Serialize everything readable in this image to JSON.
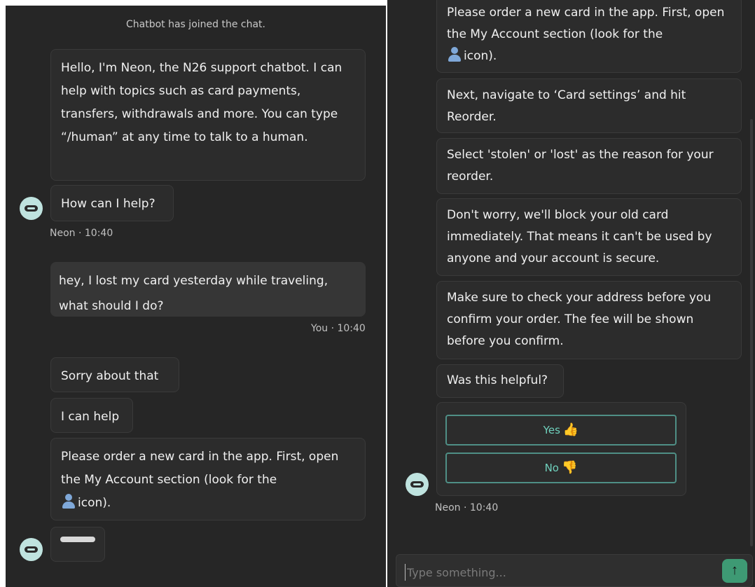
{
  "left": {
    "system_note": "Chatbot has joined the chat.",
    "greeting_text": "Hello, I'm Neon, the N26 support chatbot. I can help with topics such as card payments, transfers, withdrawals and more. You can type “/human” at any time to talk to a human.",
    "how_help": "How can I help?",
    "bot_meta": "Neon · 10:40",
    "user_text": "hey, I lost my card yesterday while traveling, what should I do?",
    "user_meta": "You · 10:40",
    "sorry": "Sorry about that",
    "can_help": "I can help",
    "order_text_a": "Please order a new card in the app. First, open the My Account section (look for the",
    "order_text_b": "icon)."
  },
  "right": {
    "order_text_a": "Please order a new card in the app. First, open the My Account section (look for the",
    "order_text_b": "icon).",
    "next_step": "Next, navigate to ‘Card settings’ and hit Reorder.",
    "select_reason": "Select 'stolen' or 'lost' as the reason for your reorder.",
    "dont_worry": "Don't worry, we'll block your old card immediately. That means it can't be used by anyone and your account is secure.",
    "make_sure": "Make sure to check your address before you confirm your order. The fee will be shown before you confirm.",
    "was_helpful": "Was this helpful?",
    "yes_label": "Yes",
    "yes_emoji": "👍",
    "no_label": "No",
    "no_emoji": "👎",
    "bot_meta": "Neon · 10:40"
  },
  "composer": {
    "placeholder": "Type something...",
    "send_icon": "arrow-up-icon",
    "send_glyph": "↑"
  },
  "icons": {
    "bot_avatar": "robot-icon",
    "account_icon": "person-icon"
  },
  "colors": {
    "background": "#262626",
    "bubble": "#2c2c2c",
    "accent": "#4f8f86",
    "send": "#3e9a74"
  }
}
